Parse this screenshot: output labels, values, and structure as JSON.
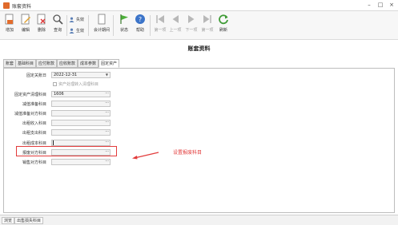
{
  "window": {
    "title": "账套资料"
  },
  "toolbar": {
    "add": "增加",
    "edit": "编辑",
    "delete": "删除",
    "query": "查询",
    "deactivate": "失效",
    "activate": "生效",
    "accounting_period": "会计期间",
    "status": "状态",
    "help": "帮助",
    "first": "第一项",
    "prev": "上一项",
    "next": "下一项",
    "last": "第一项",
    "refresh": "刷新"
  },
  "page": {
    "heading": "账套资料"
  },
  "tabs": [
    "账套",
    "基础科目",
    "应付账款",
    "应收账款",
    "成本参数",
    "固定资产"
  ],
  "form": {
    "close_date_label": "固定关账日",
    "close_date_value": "2022-12-31",
    "asset_checkbox_label": "资产处理转入清理科目",
    "asset_account_label": "固定资产清理科目",
    "asset_account_value": "1606",
    "impairment_label": "减值准备科目",
    "impairment_offset_label": "减值准备对方科目",
    "rental_income_label": "出租收入科目",
    "rental_expense_label": "出租支出科目",
    "rental_cost_label": "出租成本科目",
    "scrap_label": "报废对方科目",
    "sale_label": "销售对方科目"
  },
  "annotation": {
    "text": "设置报废科目"
  },
  "statusbar": {
    "browse": "浏览",
    "dept_subject": "出售损失科目"
  },
  "colors": {
    "accent": "#e23b3b",
    "toolbar_bg": "#f7f7f7"
  }
}
